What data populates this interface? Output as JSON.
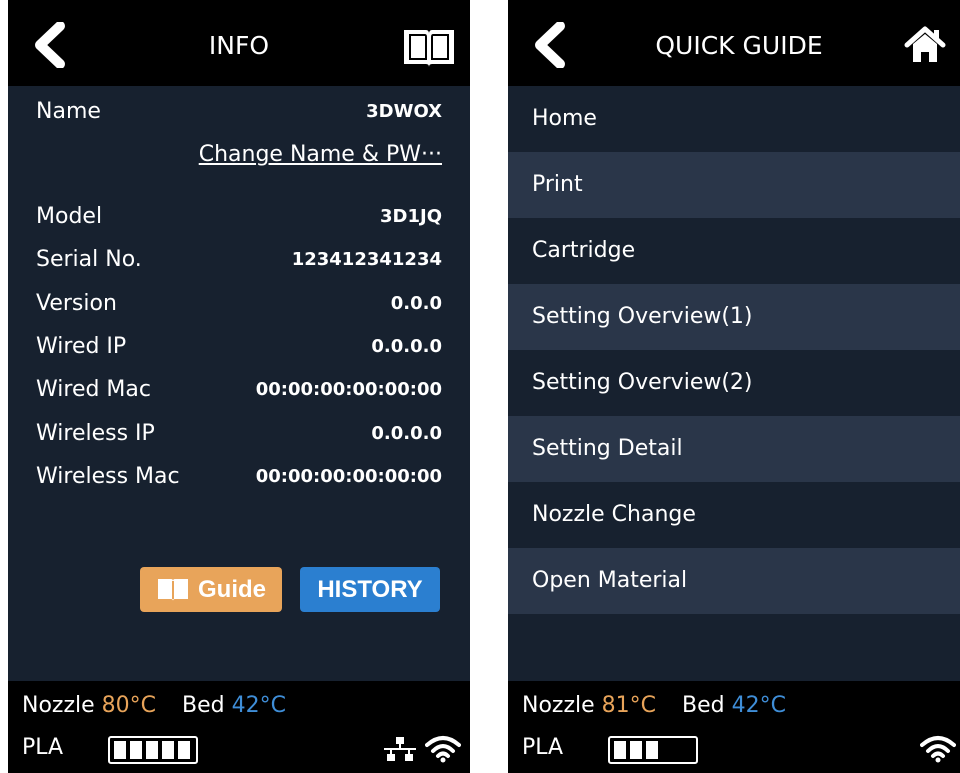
{
  "info_screen": {
    "title": "INFO",
    "back_icon": "chevron-left-icon",
    "manual_icon": "book-icon",
    "name": {
      "label": "Name",
      "value": "3DWOX"
    },
    "change_link": "Change Name & PW···",
    "details": [
      {
        "label": "Model",
        "value": "3D1JQ"
      },
      {
        "label": "Serial No.",
        "value": "123412341234"
      },
      {
        "label": "Version",
        "value": "0.0.0"
      },
      {
        "label": "Wired IP",
        "value": "0.0.0.0"
      },
      {
        "label": "Wired Mac",
        "value": "00:00:00:00:00:00"
      },
      {
        "label": "Wireless IP",
        "value": "0.0.0.0"
      },
      {
        "label": "Wireless Mac",
        "value": "00:00:00:00:00:00"
      }
    ],
    "guide_button": "Guide",
    "history_button": "HISTORY",
    "status": {
      "nozzle_label": "Nozzle",
      "nozzle_temp": "80°C",
      "bed_label": "Bed",
      "bed_temp": "42°C",
      "material": "PLA",
      "material_level_cells": 5,
      "material_capacity_cells": 5,
      "icons": [
        "wired-network-icon",
        "wifi-icon"
      ]
    }
  },
  "guide_screen": {
    "title": "QUICK GUIDE",
    "back_icon": "chevron-left-icon",
    "home_icon": "home-icon",
    "items": [
      {
        "label": "Home"
      },
      {
        "label": "Print"
      },
      {
        "label": "Cartridge"
      },
      {
        "label": "Setting Overview(1)"
      },
      {
        "label": "Setting Overview(2)"
      },
      {
        "label": "Setting Detail"
      },
      {
        "label": "Nozzle Change"
      },
      {
        "label": "Open Material"
      }
    ],
    "status": {
      "nozzle_label": "Nozzle",
      "nozzle_temp": "81°C",
      "bed_label": "Bed",
      "bed_temp": "42°C",
      "material": "PLA",
      "material_level_cells": 3,
      "material_capacity_cells": 5,
      "icons": [
        "wifi-icon"
      ]
    }
  },
  "colors": {
    "background": "#17212f",
    "bar": "#000000",
    "row_alt": "#2a3649",
    "nozzle_temp": "#e8a45a",
    "bed_temp": "#3f8ed8",
    "guide_button": "#e8a45a",
    "history_button": "#2b7fd0"
  }
}
